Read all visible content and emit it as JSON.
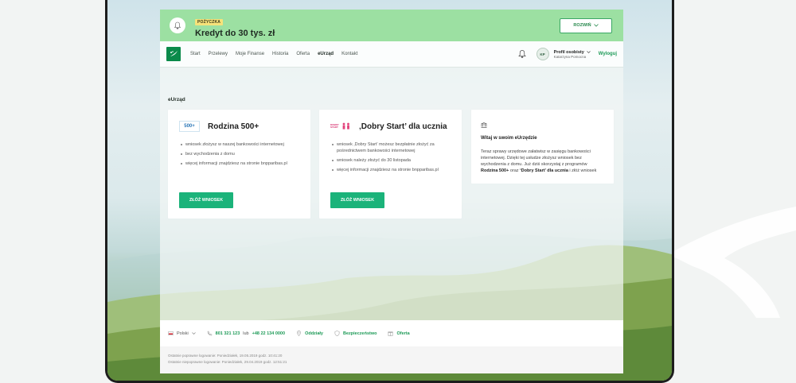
{
  "promo": {
    "badge": "POŻYCZKA",
    "title": "Kredyt do 30 tys. zł",
    "button": "ROZWIŃ"
  },
  "nav": {
    "items": [
      "Start",
      "Przelewy",
      "Moje Finanse",
      "Historia",
      "Oferta",
      "eUrząd",
      "Kontakt"
    ],
    "active": "eUrząd",
    "avatar_initials": "KP",
    "profile_label": "Profil osobisty",
    "profile_name": "Katarzyna Pomocna",
    "logout": "Wyloguj"
  },
  "page": {
    "title": "eUrząd"
  },
  "cards": [
    {
      "logo_text": "500+",
      "title": "Rodzina 500+",
      "bullets": [
        "wniosek złożysz w naszej bankowości internetowej",
        "bez wychodzenia z domu",
        "więcej informacji znajdziesz na stronie bnpparibas.pl"
      ],
      "cta": "ZŁÓŻ WNIOSEK"
    },
    {
      "logo_text": "DOBRY START",
      "title": "‚Dobry Start’ dla ucznia",
      "bullets": [
        "wniosek ‚Dobry Start’ możesz bezpłatnie złożyć za pośrednictwem bankowości internetowej",
        "wniosek należy złożyć do 30 listopada",
        "więcej informacji znajdziesz na stronie bnpparibas.pl"
      ],
      "cta": "ZŁÓŻ WNIOSEK"
    }
  ],
  "welcome": {
    "title": "Witaj w swoim eUrzędzie",
    "text_before": "Teraz sprawy urzędowe załatwisz w zasięgu bankowości internetowej. Dzięki tej usłudze złożysz wniosek bez wychodzenia z domu. Już dziś skorzystaj z programów ",
    "bold1": "Rodzina 500+",
    "text_mid": " oraz ",
    "bold2": "‘Dobry Start’ dla ucznia",
    "text_after": " i złóż wniosek"
  },
  "footer": {
    "language": "Polski",
    "phone1": "801 321 123",
    "or": "lub",
    "phone2": "+48 22 134 0000",
    "branches": "Oddziały",
    "security": "Bezpieczeństwo",
    "offer": "Oferta"
  },
  "login_info": {
    "last_ok": "Ostatnie poprawne logowanie:  Poniedziałek, 19.05.2019 godz. 10:41:20",
    "last_failed": "Ostatnie niepoprawne logowanie:  Poniedziałek, 29.04.2019 godz. 12:51:21"
  },
  "colors": {
    "accent": "#1bb37a",
    "promo_bg": "#9ce0a2",
    "link": "#1d9a57"
  }
}
